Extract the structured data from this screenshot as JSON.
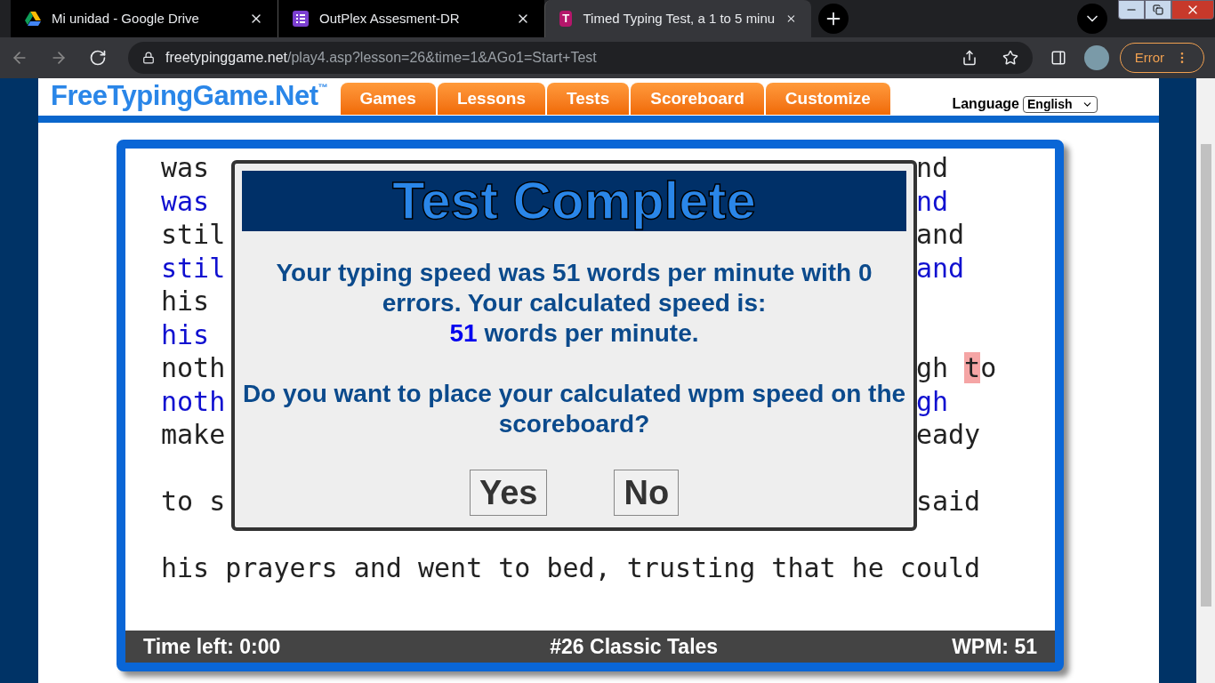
{
  "browser": {
    "tabs": [
      {
        "title": "Mi unidad - Google Drive",
        "kind": "drive",
        "selected": false
      },
      {
        "title": "OutPlex Assesment-DR",
        "kind": "list",
        "selected": false
      },
      {
        "title": "Timed Typing Test, a 1 to 5 minu",
        "kind": "letter",
        "favicon_text": "T",
        "selected": true
      }
    ],
    "address": {
      "domain": "freetypinggame.net",
      "path": "/play4.asp?lesson=26&time=1&AGo1=Start+Test"
    },
    "profile_status": "Error"
  },
  "site": {
    "logo": "FreeTypingGame.Net",
    "logo_mark": "™",
    "nav": [
      "Games",
      "Lessons",
      "Tests",
      "Scoreboard",
      "Customize"
    ],
    "language_label": "Language",
    "language_value": "English"
  },
  "typing": {
    "lines": [
      {
        "kind": "source",
        "left": "was",
        "right": "nd"
      },
      {
        "kind": "typed",
        "left": "was",
        "right": "nd"
      },
      {
        "kind": "source",
        "left": "stil",
        "right": "and"
      },
      {
        "kind": "typed",
        "left": "stil",
        "right": "and"
      },
      {
        "kind": "source",
        "left": "his"
      },
      {
        "kind": "typed",
        "left": "his"
      },
      {
        "kind": "source",
        "left": "noth",
        "right": "gh ",
        "error_char": "t",
        "right_after": "o"
      },
      {
        "kind": "typed",
        "left": "noth",
        "right": "gh"
      },
      {
        "kind": "source",
        "left": "make",
        "right": "eady"
      },
      {
        "kind": "blank"
      },
      {
        "kind": "source",
        "left": "to s",
        "right": "said"
      },
      {
        "kind": "blank"
      },
      {
        "kind": "source",
        "left": "his prayers and went to bed, trusting that he could"
      }
    ],
    "footer": {
      "time_left": "Time left: 0:00",
      "lesson": "#26 Classic Tales",
      "wpm": "WPM: 51"
    }
  },
  "modal": {
    "title": "Test Complete",
    "message": "Your typing speed was 51 words per minute with 0 errors. Your calculated speed is:",
    "speed": "51",
    "speed_unit": "words per minute.",
    "question": "Do you want to place your calculated wpm speed on the scoreboard?",
    "buttons": [
      "Yes",
      "No"
    ]
  }
}
